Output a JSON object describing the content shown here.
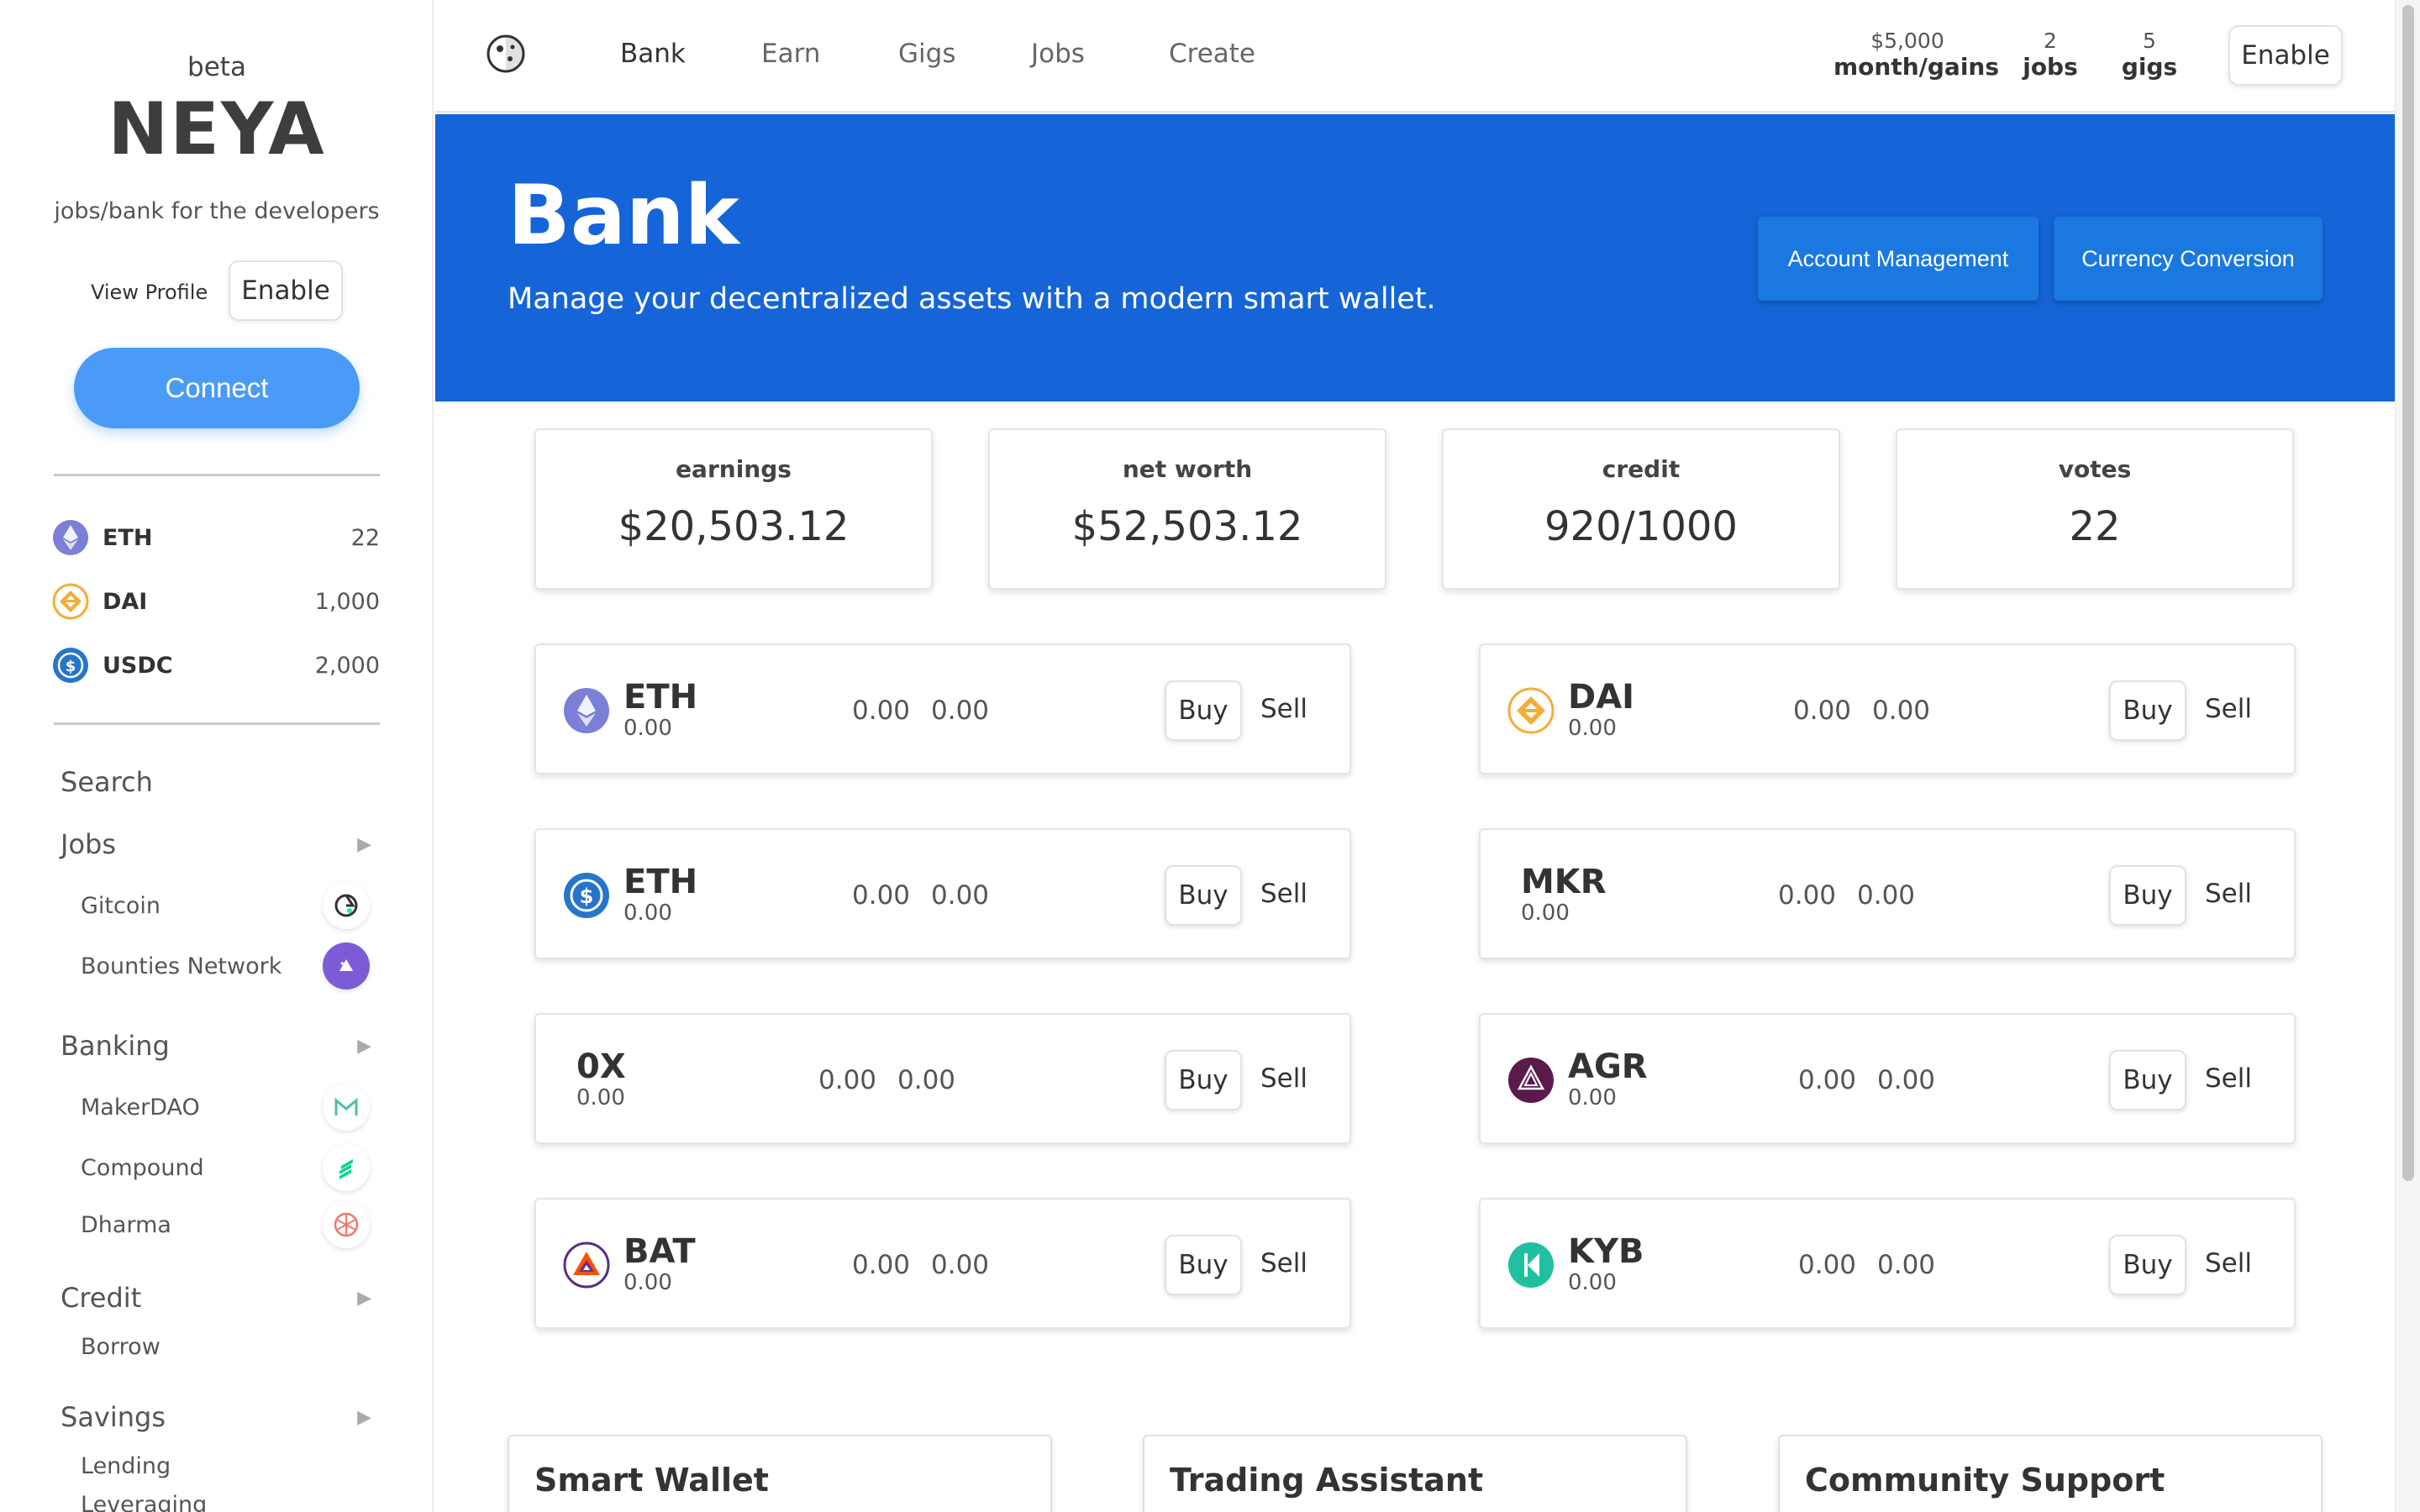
{
  "sidebar": {
    "beta": "beta",
    "logo": "NEYA",
    "tagline": "jobs/bank for the developers",
    "view_profile": "View Profile",
    "enable": "Enable",
    "connect": "Connect",
    "balances": [
      {
        "symbol": "ETH",
        "amount": "22",
        "icon": "eth-icon",
        "color": "#7b7fd6"
      },
      {
        "symbol": "DAI",
        "amount": "1,000",
        "icon": "dai-icon",
        "color": "#f5ac37"
      },
      {
        "symbol": "USDC",
        "amount": "2,000",
        "icon": "usdc-icon",
        "color": "#2775ca"
      }
    ],
    "nav": {
      "search": "Search",
      "jobs": "Jobs",
      "jobs_items": [
        "Gitcoin",
        "Bounties Network"
      ],
      "banking": "Banking",
      "banking_items": [
        "MakerDAO",
        "Compound",
        "Dharma"
      ],
      "credit": "Credit",
      "credit_items": [
        "Borrow"
      ],
      "savings": "Savings",
      "savings_items": [
        "Lending",
        "Leveraging"
      ]
    }
  },
  "topnav": {
    "links": [
      "Bank",
      "Earn",
      "Gigs",
      "Jobs",
      "Create"
    ],
    "active": "Bank",
    "stats": [
      {
        "value": "$5,000",
        "label": "month/gains"
      },
      {
        "value": "2",
        "label": "jobs"
      },
      {
        "value": "5",
        "label": "gigs"
      }
    ],
    "enable": "Enable"
  },
  "hero": {
    "title": "Bank",
    "subtitle": "Manage your decentralized assets with a modern smart wallet.",
    "buttons": [
      "Account Management",
      "Currency Conversion"
    ],
    "color": "#1565d8"
  },
  "summary": [
    {
      "label": "earnings",
      "value": "$20,503.12"
    },
    {
      "label": "net worth",
      "value": "$52,503.12"
    },
    {
      "label": "credit",
      "value": "920/1000"
    },
    {
      "label": "votes",
      "value": "22"
    }
  ],
  "assets": [
    {
      "name": "ETH",
      "balance": "0.00",
      "v1": "0.00",
      "v2": "0.00",
      "icon": "eth-icon"
    },
    {
      "name": "DAI",
      "balance": "0.00",
      "v1": "0.00",
      "v2": "0.00",
      "icon": "dai-icon"
    },
    {
      "name": "ETH",
      "balance": "0.00",
      "v1": "0.00",
      "v2": "0.00",
      "icon": "usdc-icon"
    },
    {
      "name": "MKR",
      "balance": "0.00",
      "v1": "0.00",
      "v2": "0.00",
      "icon": ""
    },
    {
      "name": "0X",
      "balance": "0.00",
      "v1": "0.00",
      "v2": "0.00",
      "icon": ""
    },
    {
      "name": "AGR",
      "balance": "0.00",
      "v1": "0.00",
      "v2": "0.00",
      "icon": "agr-icon"
    },
    {
      "name": "BAT",
      "balance": "0.00",
      "v1": "0.00",
      "v2": "0.00",
      "icon": "bat-icon"
    },
    {
      "name": "KYB",
      "balance": "0.00",
      "v1": "0.00",
      "v2": "0.00",
      "icon": "kyb-icon"
    }
  ],
  "asset_actions": {
    "buy": "Buy",
    "sell": "Sell"
  },
  "features": [
    "Smart Wallet",
    "Trading Assistant",
    "Community Support"
  ]
}
